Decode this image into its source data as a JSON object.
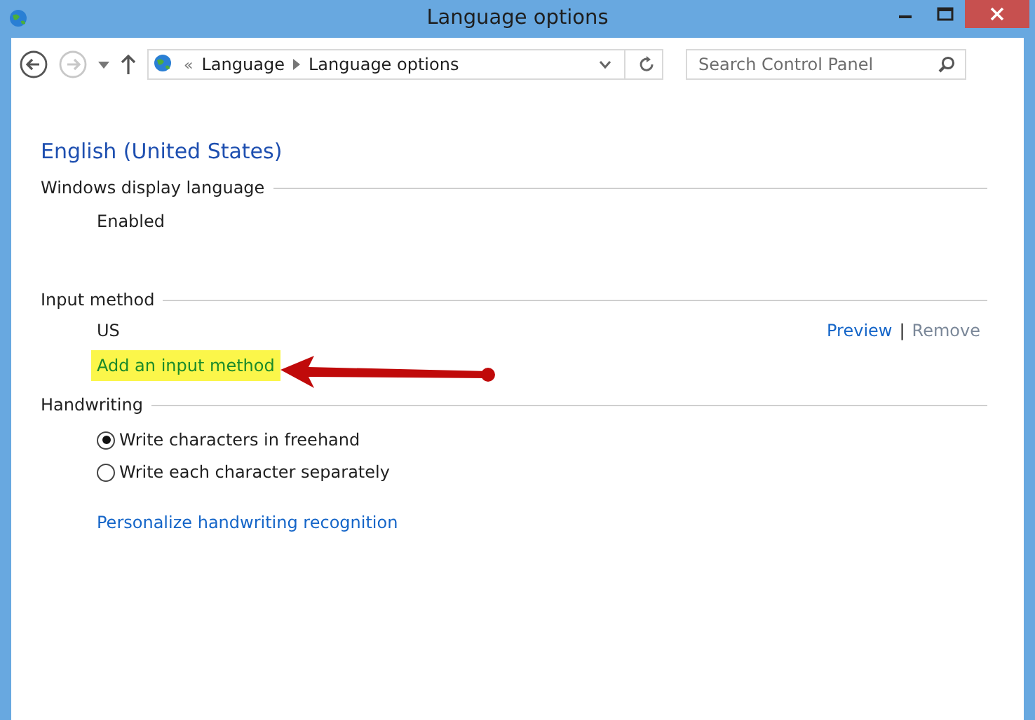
{
  "window": {
    "title": "Language options"
  },
  "nav": {
    "back_disabled": false,
    "forward_disabled": true,
    "breadcrumb": [
      {
        "label": "«"
      },
      {
        "label": "Language"
      },
      {
        "label": "Language options"
      }
    ],
    "search": {
      "placeholder": "Search Control Panel"
    }
  },
  "heading": "English (United States)",
  "sections": [
    {
      "title": "Windows display language",
      "kind": "status",
      "text": "Enabled"
    },
    {
      "title": "Input method",
      "kind": "methods",
      "methods": [
        {
          "name": "US",
          "actions": [
            {
              "label": "Preview",
              "disabled": false
            },
            {
              "label": "|",
              "kind": "separator"
            },
            {
              "label": "Remove",
              "disabled": true
            }
          ]
        }
      ],
      "add_link": {
        "label": "Add an input method",
        "highlighted": true
      }
    },
    {
      "title": "Handwriting",
      "kind": "radios",
      "options": [
        {
          "label": "Write characters in freehand",
          "selected": true
        },
        {
          "label": "Write each character separately",
          "selected": false
        }
      ],
      "link": "Personalize handwriting recognition"
    }
  ],
  "annotation": {
    "kind": "arrow"
  }
}
